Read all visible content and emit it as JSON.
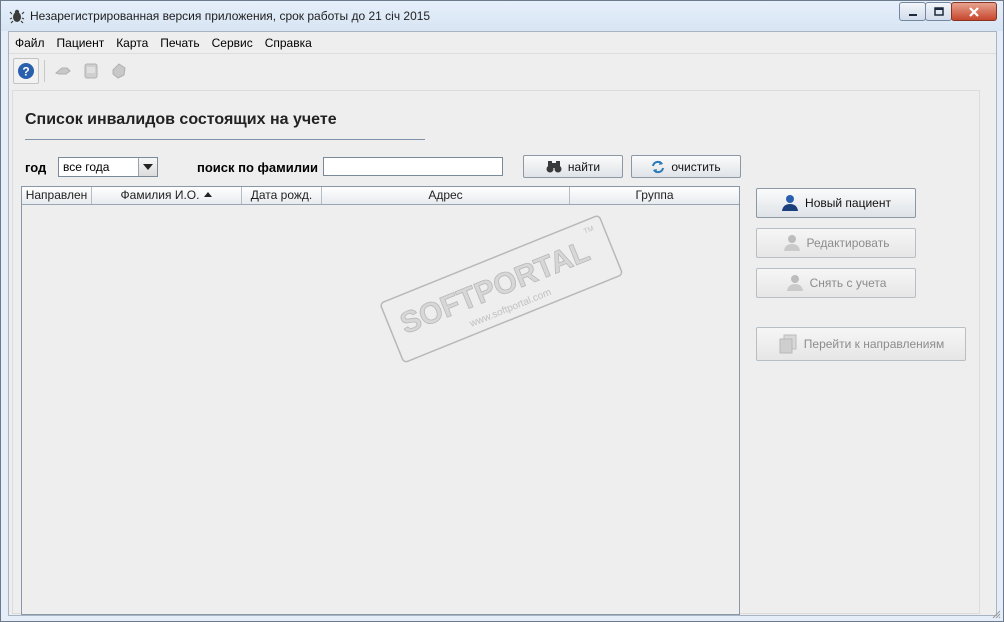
{
  "window": {
    "title": "Незарегистрированная версия приложения, срок работы до 21 січ 2015",
    "icon": "app-beetle-icon"
  },
  "menu": [
    "Файл",
    "Пациент",
    "Карта",
    "Печать",
    "Сервис",
    "Справка"
  ],
  "toolbar": {
    "icons": [
      "help-icon",
      "hand-icon",
      "document-icon",
      "tag-icon"
    ]
  },
  "page": {
    "title": "Список инвалидов состоящих на учете"
  },
  "filter": {
    "year_label": "год",
    "year_value": "все года",
    "search_label": "поиск по фамилии",
    "search_value": "",
    "find_label": "найти",
    "clear_label": "очистить"
  },
  "table": {
    "columns": [
      "Направлен",
      "Фамилия И.О.",
      "Дата рожд.",
      "Адрес",
      "Группа"
    ],
    "sorted_column": "Фамилия И.О.",
    "sort_direction": "ascending",
    "rows": []
  },
  "actions": {
    "new_patient": "Новый пациент",
    "edit": "Редактировать",
    "deregister": "Снять с учета",
    "go_referrals": "Перейти к направлениям"
  },
  "watermark": {
    "brand": "SOFTPORTAL",
    "url": "www.softportal.com",
    "tm": "TM"
  },
  "colors": {
    "accent": "#2a5fae",
    "disabled_text": "#8c8c8c",
    "panel_bg": "#eeeeee",
    "close_button": "#c8462d"
  }
}
